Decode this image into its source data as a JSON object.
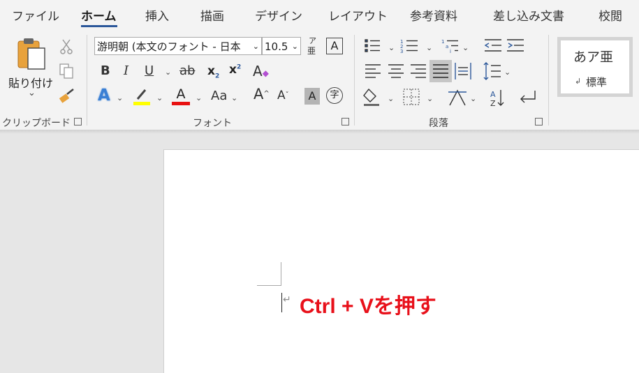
{
  "tabs": [
    "ファイル",
    "ホーム",
    "挿入",
    "描画",
    "デザイン",
    "レイアウト",
    "参考資料",
    "差し込み文書",
    "校閲"
  ],
  "active_tab": "ホーム",
  "groups": {
    "clipboard": "クリップボード",
    "font": "フォント",
    "paragraph": "段落"
  },
  "clipboard": {
    "paste_label": "貼り付け",
    "paste_dropdown": "⌄"
  },
  "font": {
    "font_name": "游明朝 (本文のフォント - 日本",
    "font_size": "10.5",
    "phonetic_top": "ア",
    "phonetic_bottom": "亜",
    "char_border": "A",
    "bold": "B",
    "italic": "I",
    "underline": "U",
    "strikethrough": "ab",
    "subscript": "x",
    "subscript_sub": "2",
    "superscript": "x",
    "superscript_sup": "2",
    "clear_format": "A",
    "text_effects": "A",
    "highlight_color": "#ffff00",
    "font_color": "A",
    "font_color_value": "#e81010",
    "change_case": "Aa",
    "grow_font": "A",
    "shrink_font": "A",
    "char_shading": "A",
    "enclose_char": "字"
  },
  "styles": {
    "preview": "あア亜",
    "name": "標準",
    "mark": "↲"
  },
  "document": {
    "paragraph_mark": "↵",
    "instruction": "Ctrl + Vを押す",
    "instruction_color": "#e8101a"
  },
  "colors": {
    "accent": "#2b579a",
    "ribbon_bg": "#f3f3f3",
    "canvas_bg": "#e6e6e6"
  }
}
